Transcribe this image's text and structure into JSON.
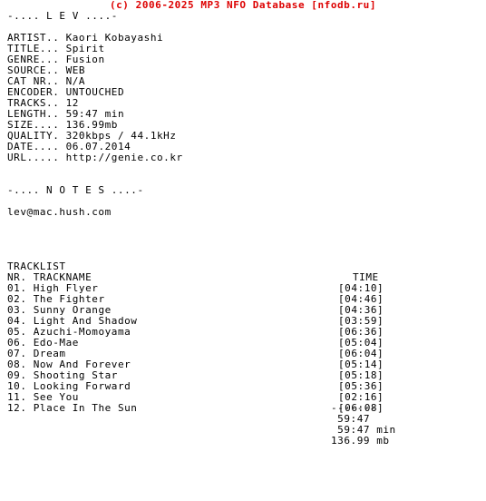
{
  "banner": {
    "text": "(c) 2006-2025 MP3 NFO Database [nfodb.ru]",
    "color": "#dd0000"
  },
  "header": {
    "title_line": "-.... L E V ....-"
  },
  "info": {
    "rows": [
      {
        "label": "ARTIST..",
        "value": "Kaori Kobayashi"
      },
      {
        "label": "TITLE...",
        "value": "Spirit"
      },
      {
        "label": "GENRE...",
        "value": "Fusion"
      },
      {
        "label": "SOURCE..",
        "value": "WEB"
      },
      {
        "label": "CAT NR..",
        "value": "N/A"
      },
      {
        "label": "ENCODER.",
        "value": "UNTOUCHED"
      },
      {
        "label": "TRACKS..",
        "value": "12"
      },
      {
        "label": "LENGTH..",
        "value": "59:47 min"
      },
      {
        "label": "SIZE....",
        "value": "136.99mb"
      },
      {
        "label": "QUALITY.",
        "value": "320kbps / 44.1kHz"
      },
      {
        "label": "DATE....",
        "value": "06.07.2014"
      },
      {
        "label": "URL.....",
        "value": "http://genie.co.kr"
      }
    ]
  },
  "notes": {
    "title_line": "-.... N O T E S ....-",
    "body": "lev@mac.hush.com"
  },
  "tracklist": {
    "section_label": "TRACKLIST",
    "header_nr": "NR.",
    "header_name": "TRACKNAME",
    "header_time": "TIME",
    "tracks": [
      {
        "nr": "01.",
        "name": "High Flyer",
        "time": "[04:10]"
      },
      {
        "nr": "02.",
        "name": "The Fighter",
        "time": "[04:46]"
      },
      {
        "nr": "03.",
        "name": "Sunny Orange",
        "time": "[04:36]"
      },
      {
        "nr": "04.",
        "name": "Light And Shadow",
        "time": "[03:59]"
      },
      {
        "nr": "05.",
        "name": "Azuchi-Momoyama",
        "time": "[06:36]"
      },
      {
        "nr": "06.",
        "name": "Edo-Mae",
        "time": "[05:04]"
      },
      {
        "nr": "07.",
        "name": "Dream",
        "time": "[06:04]"
      },
      {
        "nr": "08.",
        "name": "Now And Forever",
        "time": "[05:14]"
      },
      {
        "nr": "09.",
        "name": "Shooting Star",
        "time": "[05:18]"
      },
      {
        "nr": "10.",
        "name": "Looking Forward",
        "time": "[05:36]"
      },
      {
        "nr": "11.",
        "name": "See You",
        "time": "[02:16]"
      },
      {
        "nr": "12.",
        "name": "Place In The Sun",
        "time": "[06:08]"
      }
    ]
  },
  "summary": {
    "separator": "-------",
    "total_time": " 59:47",
    "total_length": " 59:47 min",
    "total_size": "136.99 mb"
  }
}
